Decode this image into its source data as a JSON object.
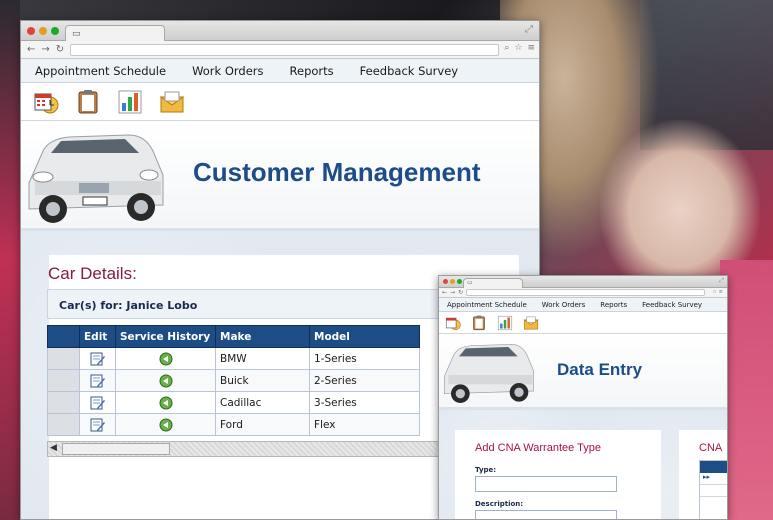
{
  "main_window": {
    "menu": [
      "Appointment Schedule",
      "Work Orders",
      "Reports",
      "Feedback Survey"
    ],
    "toolbar_icons": [
      "calendar-icon",
      "clipboard-icon",
      "bar-chart-icon",
      "mail-icon"
    ],
    "banner_title": "Customer Management",
    "section_title": "Car Details:",
    "cars_for_label": "Car(s) for:",
    "customer_name": "Janice Lobo",
    "table": {
      "headers": [
        "",
        "Edit",
        "Service History",
        "Make",
        "Model"
      ],
      "rows": [
        {
          "make": "BMW",
          "model": "1-Series"
        },
        {
          "make": "Buick",
          "model": "2-Series"
        },
        {
          "make": "Cadillac",
          "model": "3-Series"
        },
        {
          "make": "Ford",
          "model": "Flex"
        }
      ]
    }
  },
  "small_window": {
    "menu": [
      "Appointment Schedule",
      "Work Orders",
      "Reports",
      "Feedback Survey"
    ],
    "banner_title": "Data Entry",
    "form_title": "Add CNA Warrantee Type",
    "type_label": "Type:",
    "description_label": "Description:",
    "right_title": "CNA",
    "right_grid_glyph": "▸▸"
  },
  "colors": {
    "accent_blue": "#1c4c8a",
    "header_blue": "#1e4c84",
    "section_maroon": "#8a1a3c"
  }
}
